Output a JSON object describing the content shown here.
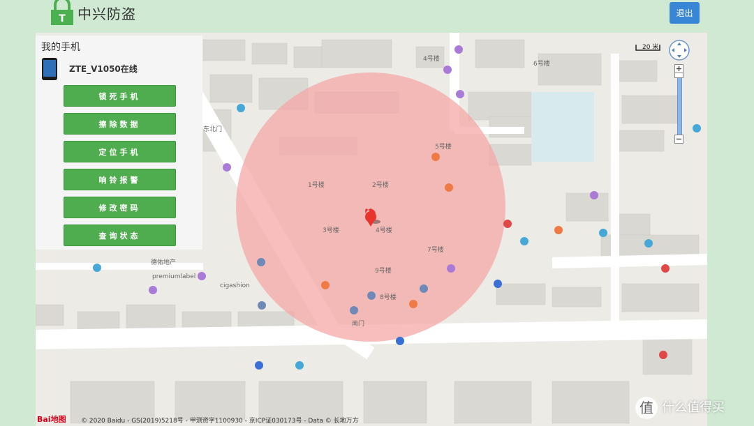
{
  "header": {
    "app_title": "中兴防盗",
    "logout_label": "退出"
  },
  "panel": {
    "title": "我的手机",
    "device_name": "ZTE_V1050在线",
    "actions": [
      "锁死手机",
      "擦除数据",
      "定位手机",
      "响铃报警",
      "修改密码",
      "查询状态"
    ]
  },
  "map": {
    "scale_label": "20 米",
    "copyright": "© 2020 Baidu - GS(2019)5218号 - 甲测资字1100930 - 京ICP证030173号 - Data © 长地万方",
    "baidu_logo": "Bai地图",
    "labels": {
      "b1": "1号楼",
      "b2": "2号楼",
      "b3": "3号楼",
      "b4": "4号楼",
      "b4n": "4号楼",
      "b5": "5号楼",
      "b6": "6号楼",
      "b7": "7号楼",
      "b8": "8号楼",
      "b9": "9号楼",
      "premium": "premiumlabel",
      "cigashion": "cigashion",
      "gate": "南门",
      "north": "东北门",
      "devproperty": "德佑地产"
    },
    "location_circle_color": "#f4a0a0",
    "marker_color": "#e8342c"
  },
  "watermark": {
    "text": "什么值得买",
    "badge": "值"
  }
}
